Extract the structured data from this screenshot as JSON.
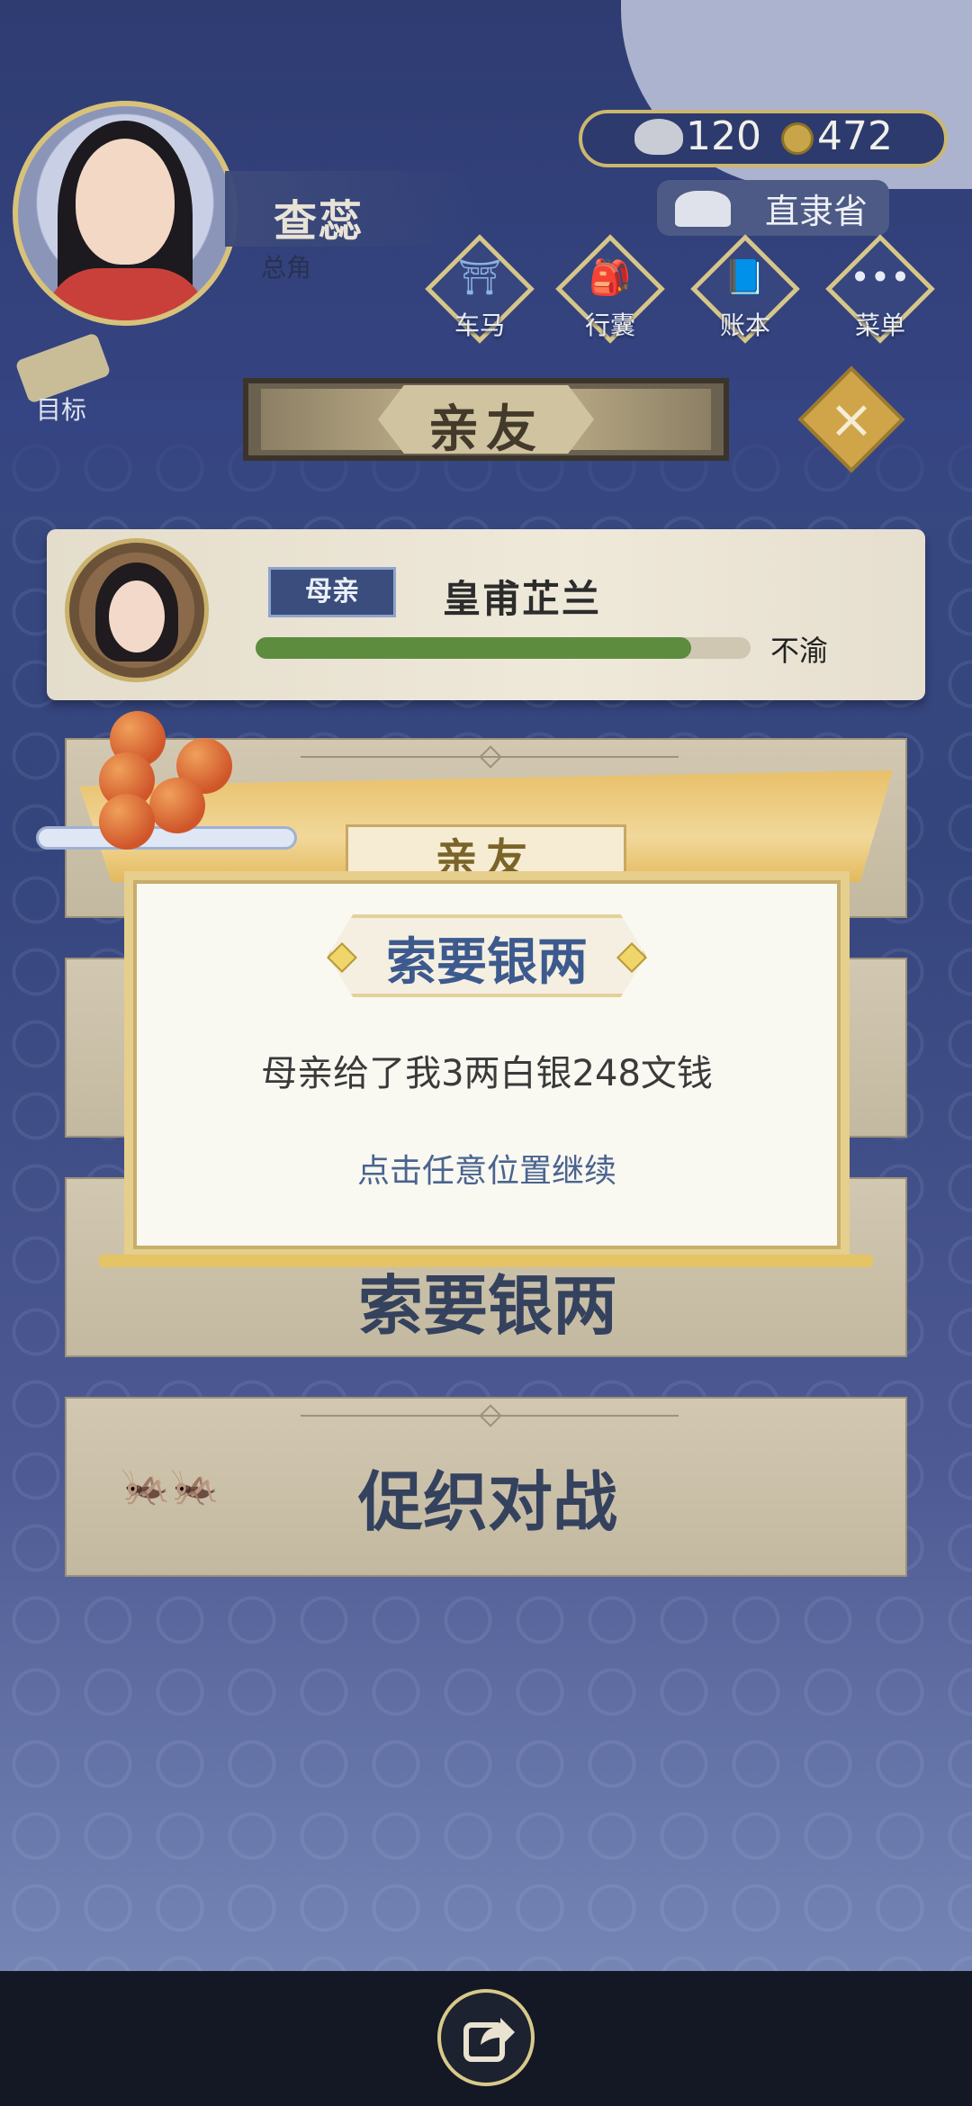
{
  "player": {
    "name": "查蕊",
    "role": "总角"
  },
  "currency": {
    "silver": "120",
    "coins": "472"
  },
  "location": "直隶省",
  "quick_menu": [
    {
      "label": "车马",
      "icon": "carriage-icon"
    },
    {
      "label": "行囊",
      "icon": "bag-icon"
    },
    {
      "label": "账本",
      "icon": "ledger-icon"
    },
    {
      "label": "菜单",
      "icon": "menu-dots-icon"
    }
  ],
  "goal": {
    "label": "目标"
  },
  "banner": {
    "title": "亲友"
  },
  "relative": {
    "relation": "母亲",
    "name": "皇甫芷兰",
    "mood": "不渝",
    "bar_level": 0.88
  },
  "actions": [
    {
      "label": ""
    },
    {
      "label": ""
    },
    {
      "label": "索要银两"
    },
    {
      "label": "促织对战"
    }
  ],
  "popup": {
    "tab_title": "亲友",
    "heading": "索要银两",
    "message": "母亲给了我3两白银248文钱",
    "hint": "点击任意位置继续"
  },
  "colors": {
    "accent_gold": "#d8c27a",
    "panel_blue": "#3b4d7c",
    "bar_green": "#5d8c3f"
  }
}
